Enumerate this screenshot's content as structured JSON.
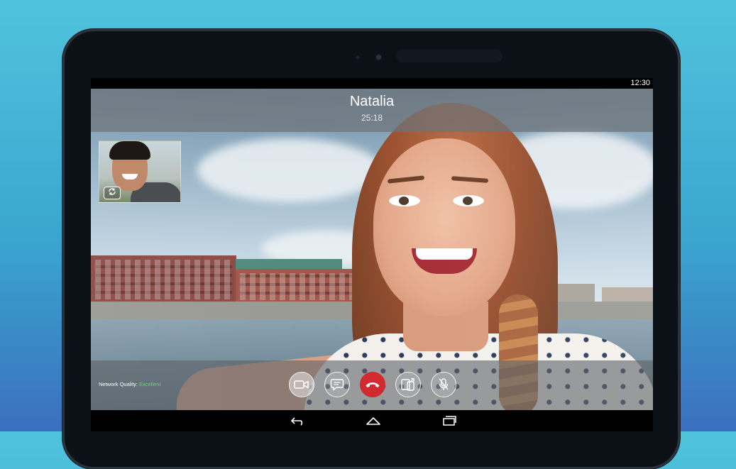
{
  "status_bar": {
    "time": "12:30"
  },
  "call": {
    "caller_name": "Natalia",
    "duration": "25:18"
  },
  "network": {
    "label": "Network Quality:",
    "value": "Excellent",
    "value_color": "#5fe04a"
  },
  "controls": [
    {
      "name": "video-toggle",
      "icon": "video-camera-icon"
    },
    {
      "name": "chat",
      "icon": "chat-bubble-icon"
    },
    {
      "name": "end-call",
      "icon": "phone-hangup-icon",
      "color": "#d12b2f"
    },
    {
      "name": "transfer-call",
      "icon": "device-transfer-icon"
    },
    {
      "name": "mute",
      "icon": "mic-muted-icon"
    }
  ],
  "pip": {
    "icon": "switch-camera-icon"
  },
  "nav": [
    "back-icon",
    "home-icon",
    "recent-apps-icon"
  ],
  "colors": {
    "background_top": "#4fc3dc",
    "background_bottom": "#3b6fbe",
    "hangup": "#d12b2f"
  }
}
